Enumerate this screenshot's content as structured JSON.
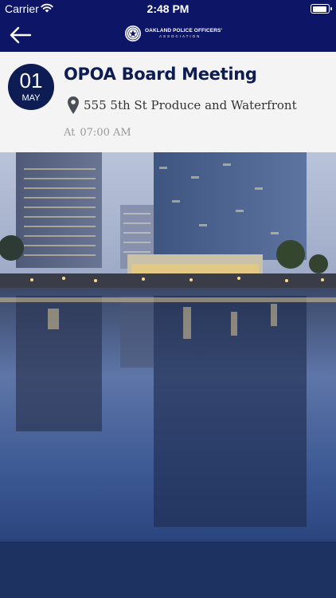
{
  "status_bar": {
    "carrier": "Carrier",
    "time": "2:48 PM",
    "icons": [
      "wifi-icon",
      "battery-icon"
    ]
  },
  "nav": {
    "back_icon": "arrow-left-icon",
    "logo_line1": "OAKLAND POLICE OFFICERS'",
    "logo_line2": "ASSOCIATION"
  },
  "event": {
    "day": "01",
    "month": "MAY",
    "title": "OPOA Board Meeting",
    "location": "555 5th St Produce and Waterfront",
    "time_prefix": "At",
    "time": "07:00 AM",
    "location_icon": "map-pin-icon"
  },
  "colors": {
    "nav_background": "#0d1566",
    "badge_background": "#0e1c54",
    "title_color": "#0e1c54",
    "card_background": "#f4f4f4",
    "footer_background": "#1d3260"
  },
  "image": {
    "subject": "city-skyline-reflection-photo"
  }
}
